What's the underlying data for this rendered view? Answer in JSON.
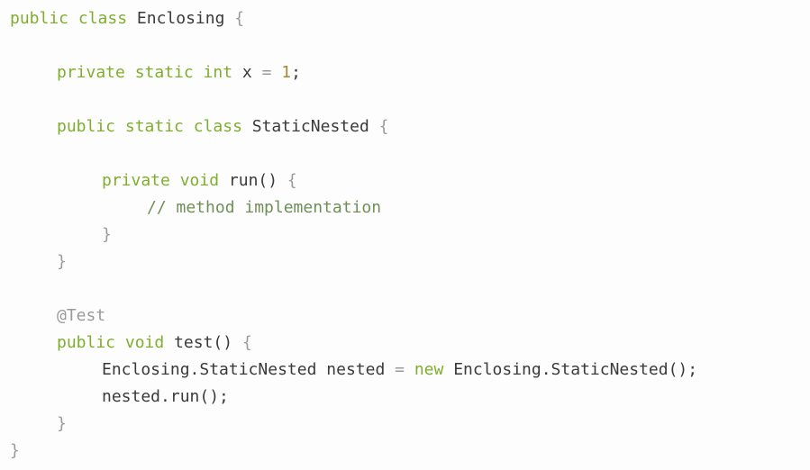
{
  "code": {
    "class_keywords": "public class",
    "class_name": "Enclosing",
    "open_brace": "{",
    "close_brace": "}",
    "field_keywords": "private static int",
    "field_name": "x",
    "field_assign": "=",
    "field_value": "1",
    "semicolon": ";",
    "nested_keywords": "public static class",
    "nested_name": "StaticNested",
    "method_keywords": "private void",
    "method_name": "run()",
    "comment": "// method implementation",
    "annotation": "@Test",
    "test_keywords": "public void",
    "test_name": "test()",
    "decl_type": "Enclosing.StaticNested",
    "decl_var": "nested",
    "decl_assign": "=",
    "decl_new": "new",
    "decl_ctor": "Enclosing.StaticNested();",
    "call": "nested.run();",
    "colors": {
      "keyword": "#7fae2e",
      "comment": "#6f8f57",
      "text": "#3a3a3a"
    }
  }
}
